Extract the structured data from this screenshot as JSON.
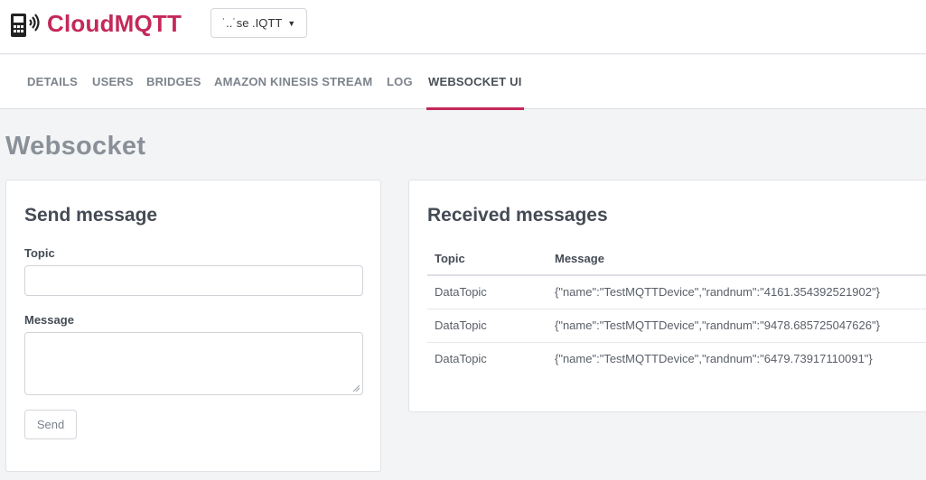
{
  "header": {
    "brand": "CloudMQTT",
    "instance_selector": "˙..˙se .IQTT",
    "brand_color": "#c4285a"
  },
  "tabs": [
    {
      "label": "DETAILS",
      "active": false
    },
    {
      "label": "USERS",
      "active": false
    },
    {
      "label": "BRIDGES",
      "active": false
    },
    {
      "label": "AMAZON KINESIS STREAM",
      "active": false
    },
    {
      "label": "LOG",
      "active": false
    },
    {
      "label": "WEBSOCKET UI",
      "active": true
    }
  ],
  "page": {
    "title": "Websocket"
  },
  "send": {
    "title": "Send message",
    "topic_label": "Topic",
    "topic_value": "",
    "message_label": "Message",
    "message_value": "",
    "send_label": "Send"
  },
  "received": {
    "title": "Received messages",
    "columns": [
      "Topic",
      "Message"
    ],
    "rows": [
      {
        "topic": "DataTopic",
        "message": "{\"name\":\"TestMQTTDevice\",\"randnum\":\"4161.354392521902\"}"
      },
      {
        "topic": "DataTopic",
        "message": "{\"name\":\"TestMQTTDevice\",\"randnum\":\"9478.685725047626\"}"
      },
      {
        "topic": "DataTopic",
        "message": "{\"name\":\"TestMQTTDevice\",\"randnum\":\"6479.73917110091\"}"
      }
    ]
  }
}
